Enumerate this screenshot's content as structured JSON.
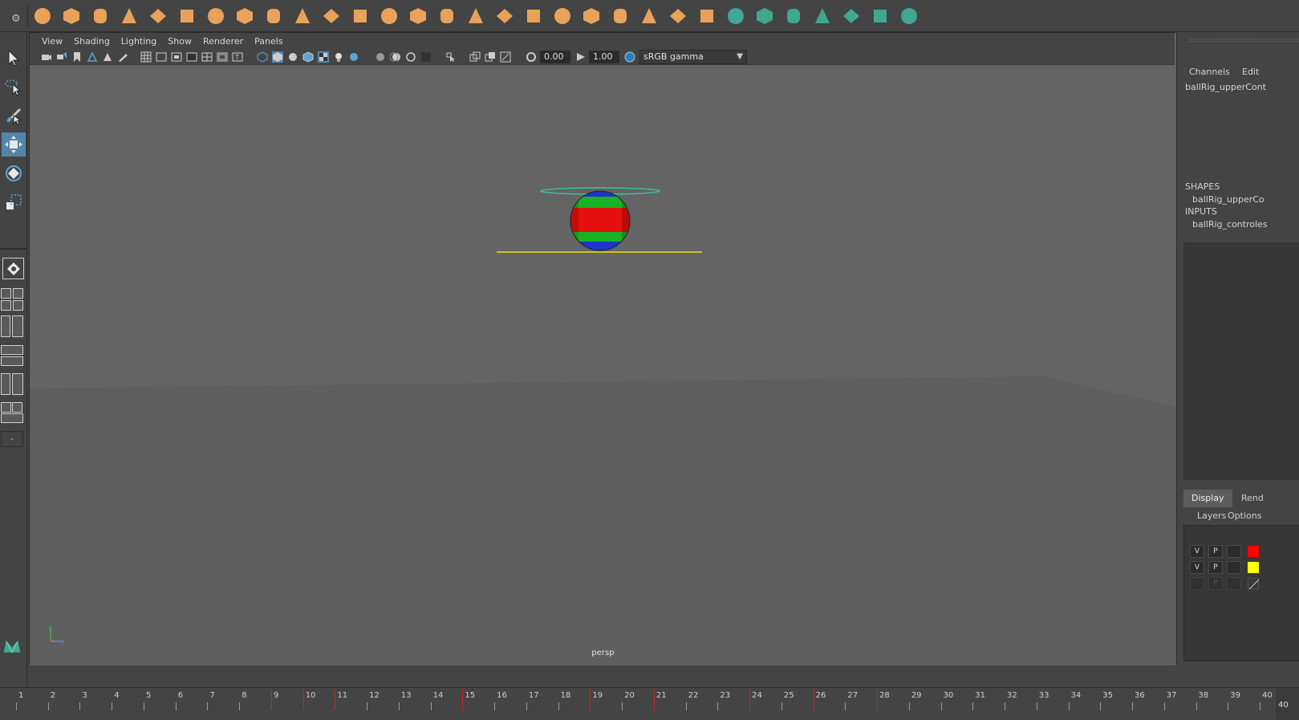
{
  "shelf": {
    "icons": [
      "sphere-icon",
      "cube-icon",
      "cylinder-icon",
      "cone-icon",
      "plane-icon",
      "torus-icon",
      "pyramid-icon",
      "pipe-icon",
      "combine-icon",
      "separate-icon",
      "smooth-icon",
      "subdivide-icon",
      "bevel-icon",
      "extrude-icon",
      "bridge-icon",
      "multicut-icon",
      "insert-loop-icon",
      "target-weld-icon",
      "uv-editor-icon",
      "center-pivot-icon",
      "freeze-transform-icon",
      "delete-history-icon",
      "align-icon",
      "bounding-box-icon",
      "curve-icon",
      "surface-icon",
      "nurbs-patch-icon",
      "loft-icon",
      "revolve-icon",
      "checker-icon",
      "deformer-icon"
    ]
  },
  "viewport": {
    "menus": [
      "View",
      "Shading",
      "Lighting",
      "Show",
      "Renderer",
      "Panels"
    ],
    "exposure": "0.00",
    "gamma": "1.00",
    "color_space": "sRGB gamma",
    "camera_label": "persp"
  },
  "channel_box": {
    "tabs": [
      "Channels",
      "Edit"
    ],
    "node_name": "ballRig_upperCont",
    "shapes_header": "SHAPES",
    "shape_item": "ballRig_upperCo",
    "inputs_header": "INPUTS",
    "input_item": "ballRig_controles"
  },
  "layer_editor": {
    "tabs": [
      "Display",
      "Rend"
    ],
    "menu": [
      "Layers",
      "Options"
    ],
    "rows": [
      {
        "v": "V",
        "p": "P",
        "color": "#ff0000"
      },
      {
        "v": "V",
        "p": "P",
        "color": "#ffff00"
      },
      {
        "v": "",
        "p": "P",
        "color": ""
      }
    ]
  },
  "timeslider": {
    "start": 1,
    "end": 40,
    "labels": [
      "1",
      "2",
      "3",
      "4",
      "5",
      "6",
      "7",
      "8",
      "9",
      "10",
      "11",
      "12",
      "13",
      "14",
      "15",
      "16",
      "17",
      "18",
      "19",
      "20",
      "21",
      "22",
      "23",
      "24",
      "25",
      "26",
      "27",
      "28",
      "29",
      "30",
      "31",
      "32",
      "33",
      "34",
      "35",
      "36",
      "37",
      "38",
      "39",
      "40"
    ],
    "keys": [
      9,
      10,
      11,
      15,
      19,
      21,
      24,
      26,
      28
    ],
    "current_frame": "40"
  },
  "colors": {
    "accent": "#5285a6",
    "shelf_orange": "#e9a25a",
    "shelf_green": "#3fa890",
    "key_red": "#c8262a"
  }
}
